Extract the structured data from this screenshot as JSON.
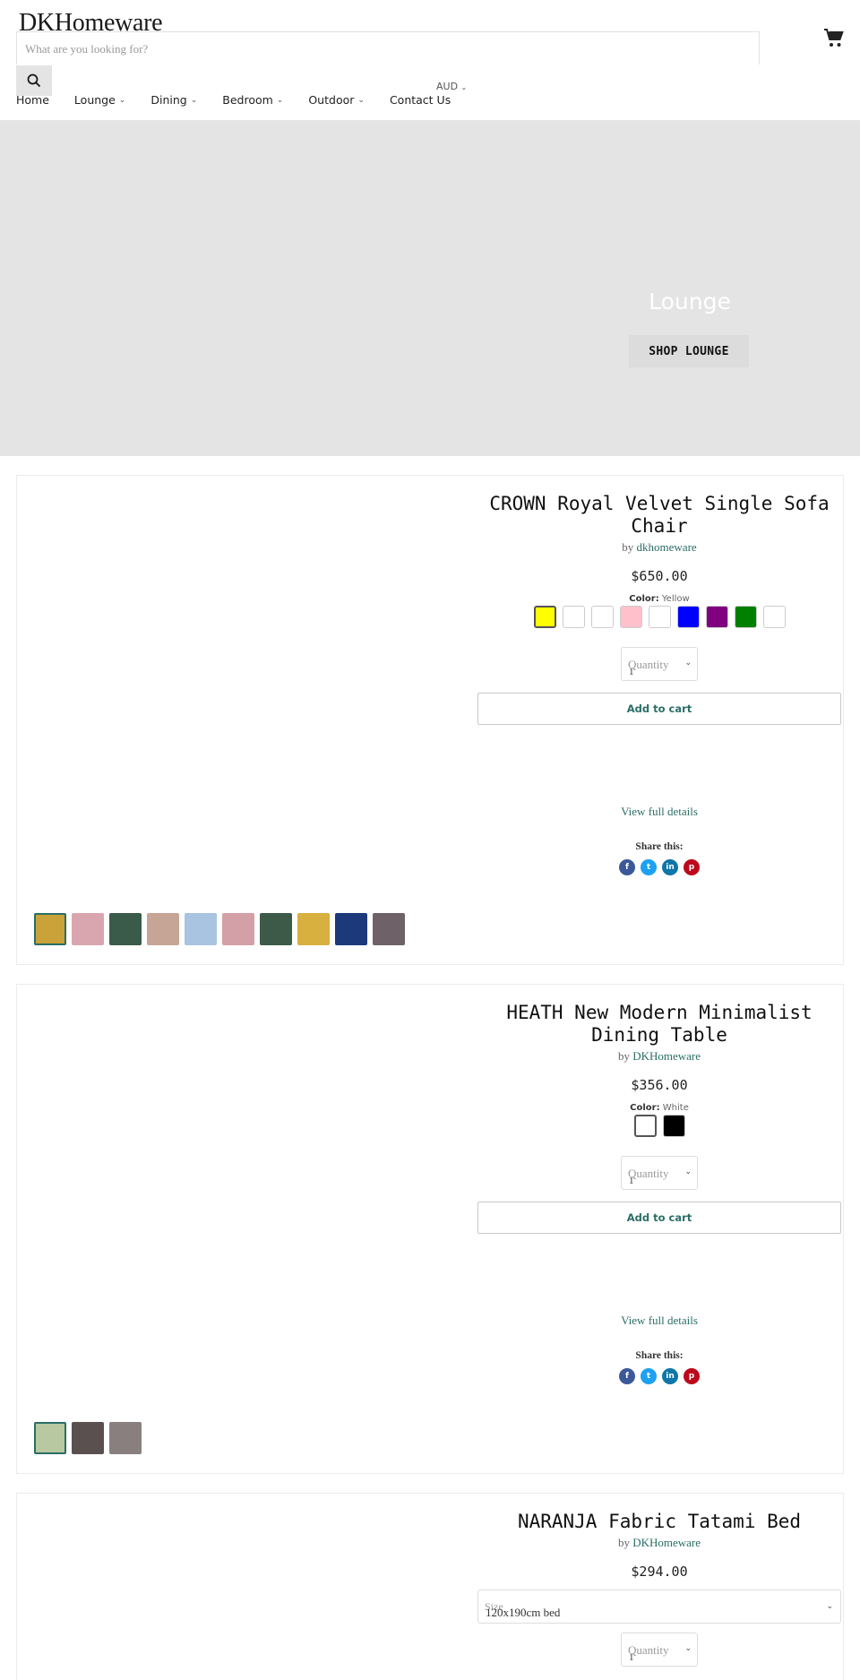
{
  "header": {
    "logo": "DKHomeware",
    "search_placeholder": "What are you looking for?",
    "currency": "AUD",
    "nav": [
      {
        "label": "Home",
        "has_dropdown": false
      },
      {
        "label": "Lounge",
        "has_dropdown": true
      },
      {
        "label": "Dining",
        "has_dropdown": true
      },
      {
        "label": "Bedroom",
        "has_dropdown": true
      },
      {
        "label": "Outdoor",
        "has_dropdown": true
      },
      {
        "label": "Contact Us",
        "has_dropdown": false
      }
    ]
  },
  "hero": {
    "title": "Lounge",
    "button": "SHOP LOUNGE"
  },
  "products": [
    {
      "title_line1": "CROWN Royal Velvet Single Sofa",
      "title_line2": "Chair",
      "by": "by",
      "vendor": "dkhomeware",
      "price": "$650.00",
      "color_label": "Color:",
      "color_value": "Yellow",
      "swatches": [
        "#ffff00",
        "#ffffff",
        "#ffffff",
        "#ffc0cb",
        "#ffffff",
        "#0000ff",
        "#800080",
        "#008000",
        "#ffffff"
      ],
      "quantity_label": "Quantity",
      "quantity_value": "1",
      "add_to_cart": "Add to cart",
      "view_details": "View full details",
      "share_label": "Share this:",
      "thumb_colors": [
        "#c9a23a",
        "#d9a6b0",
        "#3b5b4a",
        "#c7a596",
        "#a9c4e0",
        "#d4a0a8",
        "#3d5a48",
        "#d8b040",
        "#1c3a7a",
        "#6e6268"
      ]
    },
    {
      "title_line1": "HEATH New Modern Minimalist",
      "title_line2": "Dining Table",
      "by": "by",
      "vendor": "DKHomeware",
      "price": "$356.00",
      "color_label": "Color:",
      "color_value": "White",
      "swatches": [
        "#ffffff",
        "#000000"
      ],
      "quantity_label": "Quantity",
      "quantity_value": "1",
      "add_to_cart": "Add to cart",
      "view_details": "View full details",
      "share_label": "Share this:",
      "thumb_colors": [
        "#b8c8a0",
        "#5b5050",
        "#8a7f7f"
      ]
    },
    {
      "title_line1": "NARANJA Fabric Tatami Bed",
      "by": "by",
      "vendor": "DKHomeware",
      "price": "$294.00",
      "size_label": "Size",
      "size_value": "120x190cm bed",
      "quantity_label": "Quantity",
      "quantity_value": "1"
    }
  ],
  "icons": {
    "search": "search-icon",
    "cart": "cart-icon",
    "facebook": "f",
    "twitter": "t",
    "linkedin": "in",
    "pinterest": "p"
  }
}
